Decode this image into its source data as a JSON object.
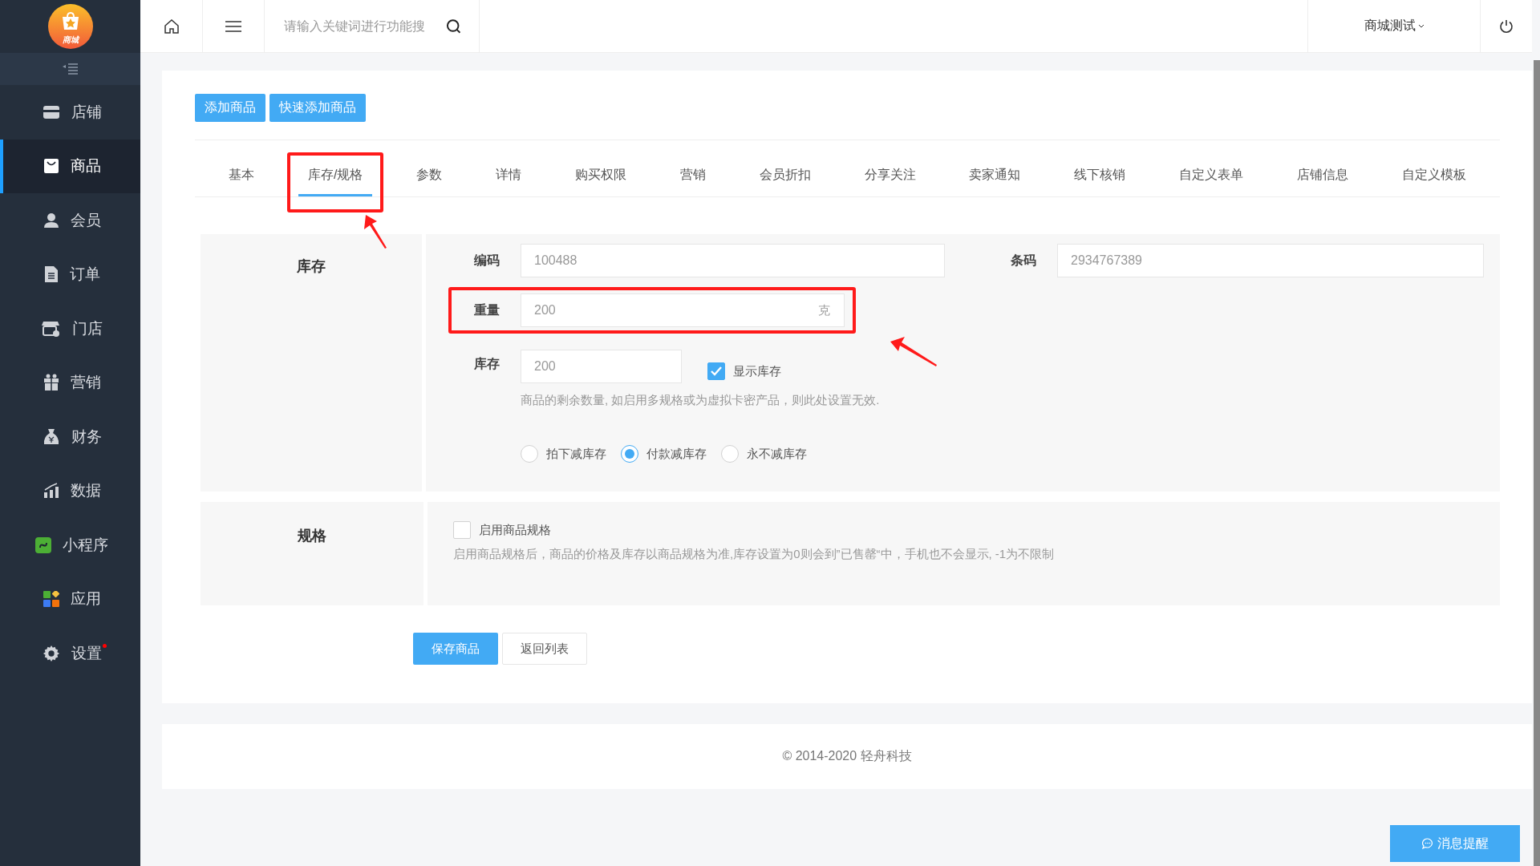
{
  "logo": {
    "badge": "商城"
  },
  "sidebar": {
    "items": [
      {
        "label": "店铺",
        "selected": false,
        "dot": false
      },
      {
        "label": "商品",
        "selected": true,
        "dot": false
      },
      {
        "label": "会员",
        "selected": false,
        "dot": false
      },
      {
        "label": "订单",
        "selected": false,
        "dot": false
      },
      {
        "label": "门店",
        "selected": false,
        "dot": false
      },
      {
        "label": "营销",
        "selected": false,
        "dot": false
      },
      {
        "label": "财务",
        "selected": false,
        "dot": false
      },
      {
        "label": "数据",
        "selected": false,
        "dot": false
      },
      {
        "label": "小程序",
        "selected": false,
        "dot": false
      },
      {
        "label": "应用",
        "selected": false,
        "dot": false
      },
      {
        "label": "设置",
        "selected": false,
        "dot": true
      }
    ]
  },
  "topbar": {
    "search": {
      "placeholder": "请输入关键词进行功能搜"
    },
    "user": "商城测试"
  },
  "buttons": [
    "添加商品",
    "快速添加商品"
  ],
  "tabs": [
    {
      "label": "基本",
      "selected": false,
      "annotated": false
    },
    {
      "label": "库存/规格",
      "selected": true,
      "annotated": true
    },
    {
      "label": "参数",
      "selected": false,
      "annotated": false
    },
    {
      "label": "详情",
      "selected": false,
      "annotated": false
    },
    {
      "label": "购买权限",
      "selected": false,
      "annotated": false
    },
    {
      "label": "营销",
      "selected": false,
      "annotated": false
    },
    {
      "label": "会员折扣",
      "selected": false,
      "annotated": false
    },
    {
      "label": "分享关注",
      "selected": false,
      "annotated": false
    },
    {
      "label": "卖家通知",
      "selected": false,
      "annotated": false
    },
    {
      "label": "线下核销",
      "selected": false,
      "annotated": false
    },
    {
      "label": "自定义表单",
      "selected": false,
      "annotated": false
    },
    {
      "label": "店铺信息",
      "selected": false,
      "annotated": false
    },
    {
      "label": "自定义模板",
      "selected": false,
      "annotated": false
    }
  ],
  "inventory": {
    "title": "库存",
    "code": {
      "label": "编码",
      "value": "100488"
    },
    "barcode": {
      "label": "条码",
      "value": "2934767389"
    },
    "weight": {
      "label": "重量",
      "value": "200",
      "unit": "克",
      "annotated": true
    },
    "stock": {
      "label": "库存",
      "value": "200"
    },
    "show_stock": {
      "label": "显示库存",
      "checked": true
    },
    "hint": "商品的剩余数量, 如启用多规格或为虚拟卡密产品，则此处设置无效.",
    "deduct_options": [
      {
        "label": "拍下减库存",
        "selected": false
      },
      {
        "label": "付款减库存",
        "selected": true
      },
      {
        "label": "永不减库存",
        "selected": false
      }
    ]
  },
  "spec": {
    "title": "规格",
    "enable": {
      "label": "启用商品规格",
      "checked": false
    },
    "hint": "启用商品规格后，商品的价格及库存以商品规格为准,库存设置为0则会到”已售罄“中，手机也不会显示, -1为不限制"
  },
  "actions": [
    "保存商品",
    "返回列表"
  ],
  "footer": "© 2014-2020 轻舟科技",
  "message_button": "消息提醒"
}
